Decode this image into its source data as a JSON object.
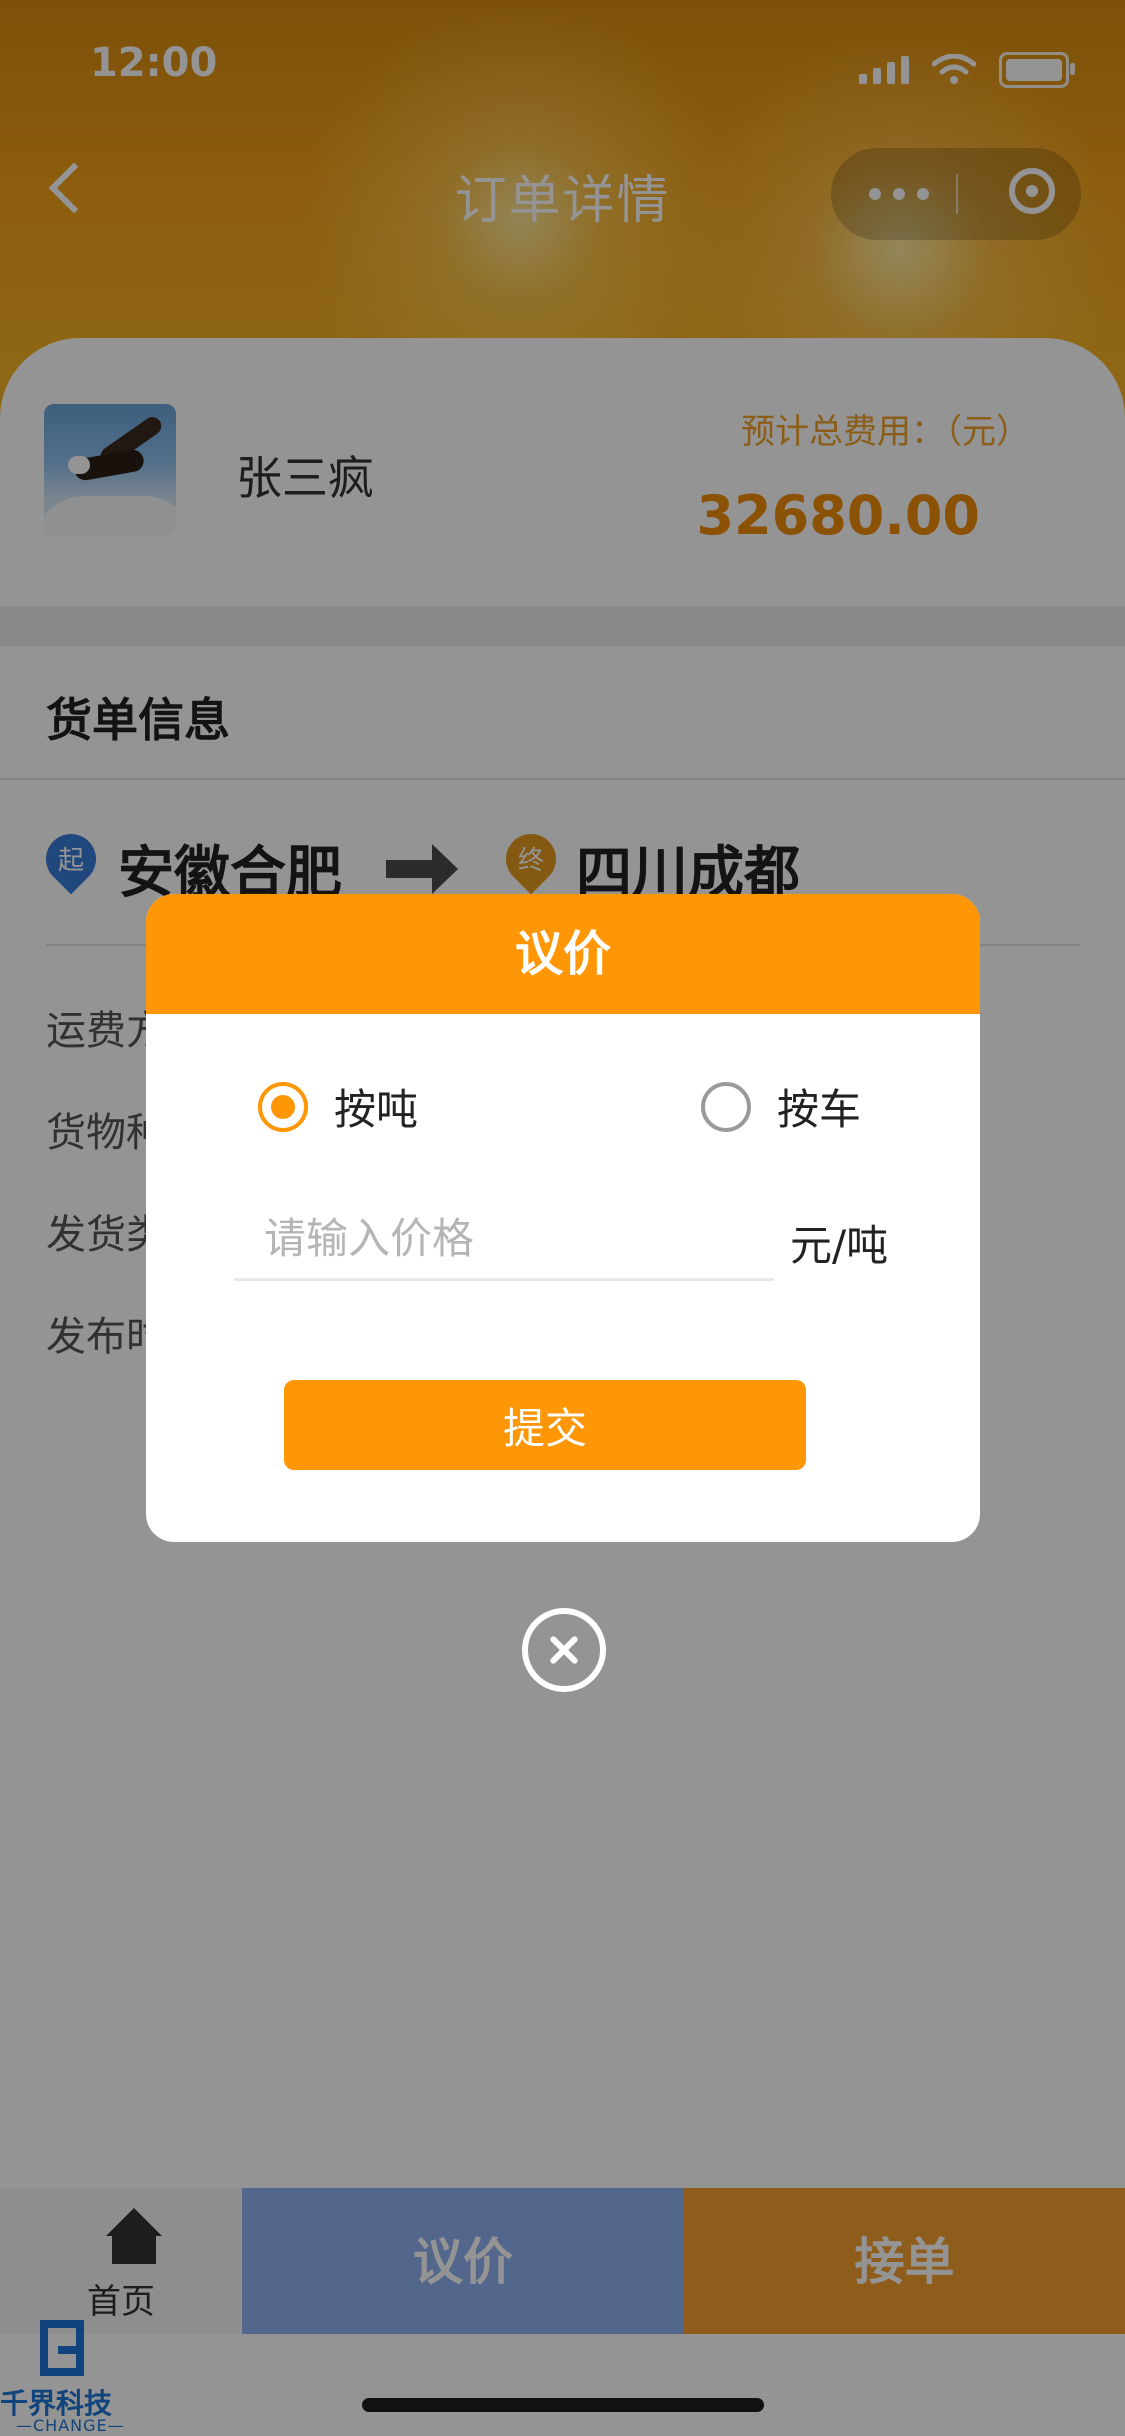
{
  "status_bar": {
    "time": "12:00"
  },
  "nav": {
    "title": "订单详情"
  },
  "user": {
    "name": "张三疯",
    "estimated_fee_label": "预计总费用：（元）",
    "estimated_fee": "32680.00"
  },
  "section": {
    "title": "货单信息"
  },
  "route": {
    "start_badge": "起",
    "from": "安徽合肥",
    "end_badge": "终",
    "to": "四川成都"
  },
  "info_rows": [
    "运费方",
    "货物种",
    "发货类",
    "发布时"
  ],
  "modal": {
    "title": "议价",
    "options": [
      {
        "label": "按吨",
        "checked": true
      },
      {
        "label": "按车",
        "checked": false
      }
    ],
    "price_placeholder": "请输入价格",
    "unit": "元/吨",
    "submit_label": "提交"
  },
  "bottom_bar": {
    "home_label": "首页",
    "negotiate_label": "议价",
    "accept_label": "接单"
  },
  "watermark": {
    "text": "千界科技",
    "sub": "—CHANGE—"
  },
  "colors": {
    "primary": "#ff9606",
    "negotiate_bg": "#8fb0f2",
    "accept_bg": "#f7a130"
  }
}
